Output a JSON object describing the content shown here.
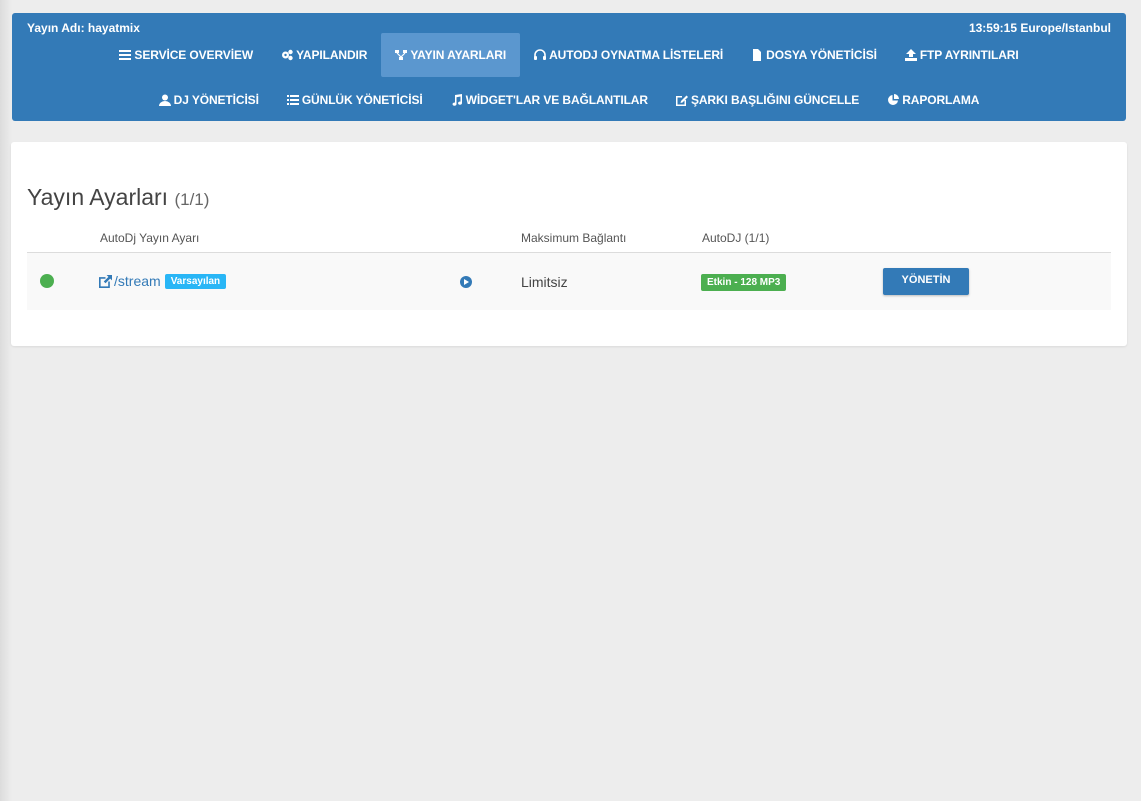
{
  "header": {
    "stream_name": "Yayın Adı: hayatmix",
    "clock": "13:59:15 Europe/Istanbul",
    "accent_color": "#337ab7"
  },
  "nav": {
    "row1": [
      {
        "label": "SERVİCE OVERVİEW",
        "icon": "bars-icon"
      },
      {
        "label": "YAPILANDIR",
        "icon": "cogs-icon"
      },
      {
        "label": "YAYIN AYARLARI",
        "icon": "sitemap-icon",
        "active": true
      },
      {
        "label": "AUTODJ OYNATMA LİSTELERİ",
        "icon": "headphones-icon"
      },
      {
        "label": "DOSYA YÖNETİCİSİ",
        "icon": "file-icon"
      },
      {
        "label": "FTP AYRINTILARI",
        "icon": "upload-icon"
      }
    ],
    "row2": [
      {
        "label": "DJ YÖNETİCİSİ",
        "icon": "user-icon"
      },
      {
        "label": "GÜNLÜK YÖNETİCİSİ",
        "icon": "list-icon"
      },
      {
        "label": "WİDGET'LAR VE BAĞLANTILAR",
        "icon": "music-icon"
      },
      {
        "label": "ŞARKI BAŞLIĞINI GÜNCELLE",
        "icon": "edit-icon"
      },
      {
        "label": "RAPORLAMA",
        "icon": "pie-chart-icon"
      }
    ]
  },
  "main": {
    "title": "Yayın Ayarları",
    "title_count": "(1/1)",
    "columns": {
      "mount": "AutoDj Yayın Ayarı",
      "max_conn": "Maksimum Bağlantı",
      "autodj": "AutoDJ (1/1)"
    },
    "rows": [
      {
        "status_color": "#4caf50",
        "mount": "/stream",
        "default_badge": "Varsayılan",
        "max_conn": "Limitsiz",
        "autodj_status": "Etkin - 128 MP3",
        "manage_label": "YÖNETİN"
      }
    ]
  }
}
